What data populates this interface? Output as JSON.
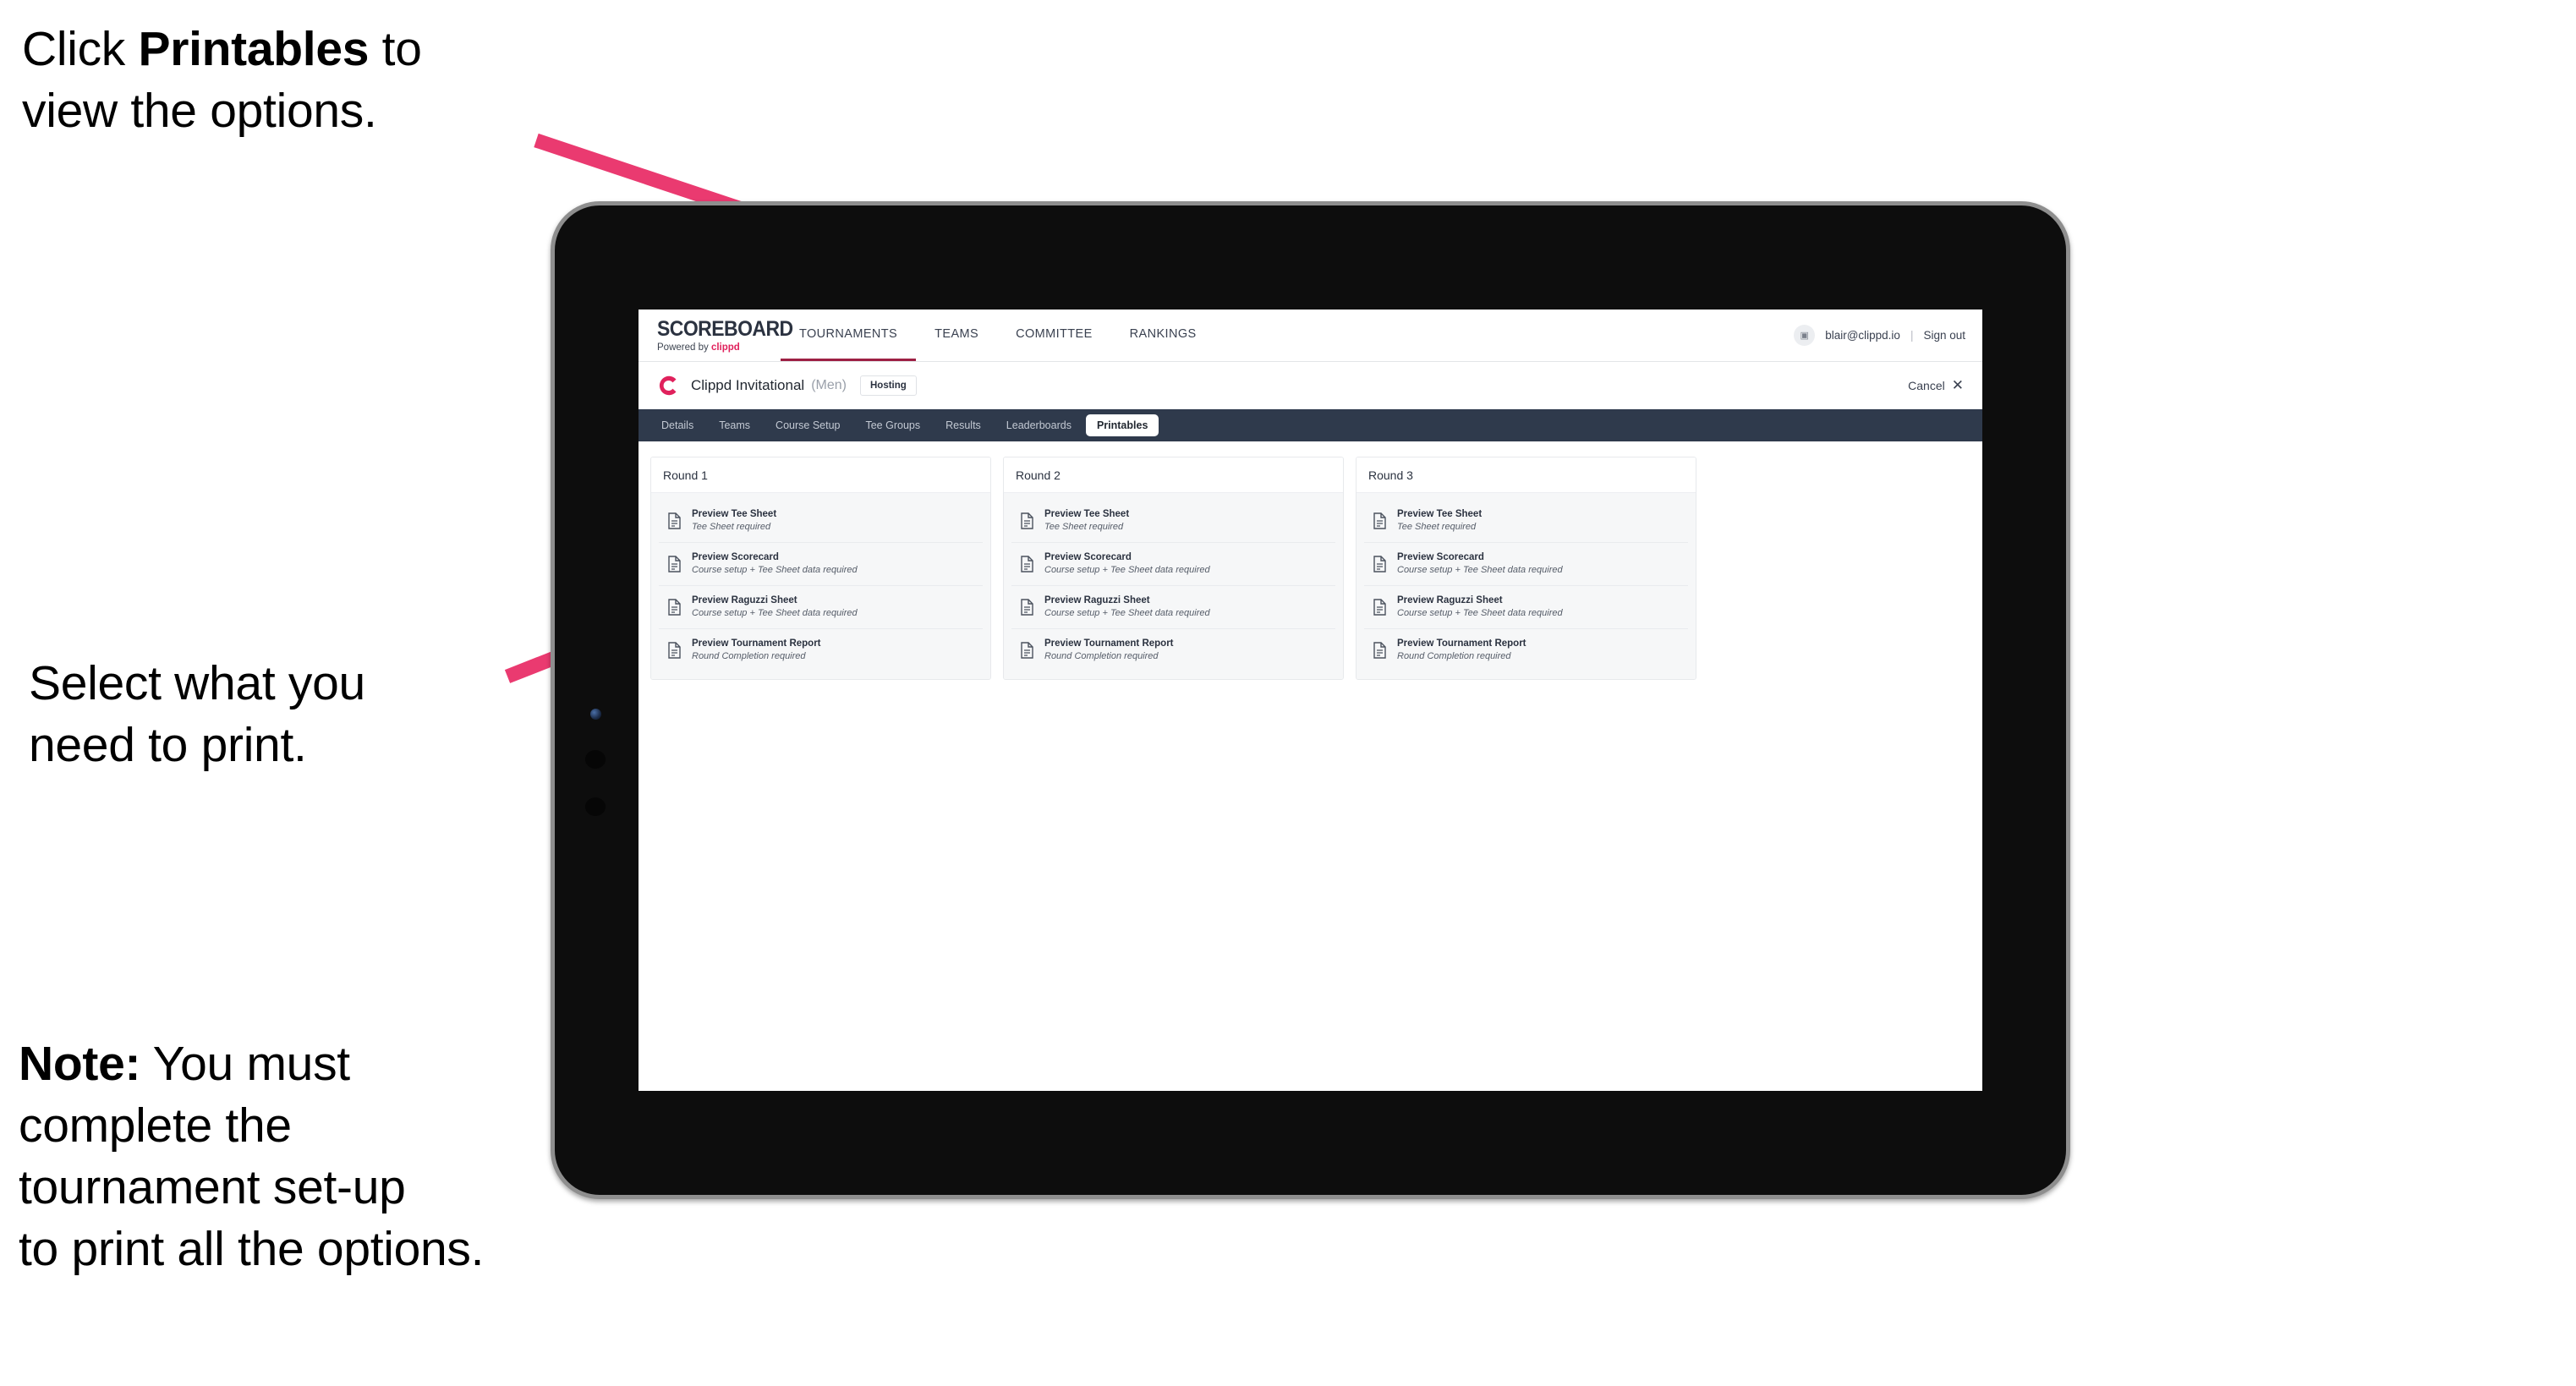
{
  "annotations": [
    {
      "id": "a1",
      "prefix": "Click ",
      "bold": "Printables",
      "suffix": " to\nview the options."
    },
    {
      "id": "a2",
      "prefix": "",
      "bold": "",
      "suffix": "Select what you\n need to print."
    },
    {
      "id": "a3",
      "prefix": "",
      "bold": "Note:",
      "suffix": " You must\ncomplete the\ntournament set-up\nto print all the options."
    }
  ],
  "annotation_text": {
    "one_pre": "Click ",
    "one_bold": "Printables",
    "one_post": " to\nview the options.",
    "two": "Select what you\n need to print.",
    "three_bold": "Note:",
    "three_post": " You must\ncomplete the\ntournament set-up\nto print all the options."
  },
  "colors": {
    "accent_pink": "#ea3a70",
    "brand_crimson": "#e0215c",
    "navbar_dark": "#2f3a4c",
    "active_underline": "#9d2044",
    "card_grey": "#f6f7f8",
    "bezel_black": "#0d0d0d",
    "bezel_edge": "#8e8e8e"
  },
  "brand": {
    "wordmark": "SCOREBOARD",
    "powered_prefix": "Powered by ",
    "powered_name": "clippd"
  },
  "main_nav": [
    {
      "label": "TOURNAMENTS",
      "active": true
    },
    {
      "label": "TEAMS",
      "active": false
    },
    {
      "label": "COMMITTEE",
      "active": false
    },
    {
      "label": "RANKINGS",
      "active": false
    }
  ],
  "account": {
    "avatar_glyph": "▣",
    "email": "blair@clippd.io",
    "separator": "|",
    "sign_out": "Sign out"
  },
  "tournament": {
    "logo_letter": "C",
    "name": "Clippd Invitational",
    "gender": "(Men)",
    "status_badge": "Hosting",
    "cancel_label": "Cancel",
    "cancel_x": "✕"
  },
  "tabs": [
    {
      "label": "Details",
      "active": false
    },
    {
      "label": "Teams",
      "active": false
    },
    {
      "label": "Course Setup",
      "active": false
    },
    {
      "label": "Tee Groups",
      "active": false
    },
    {
      "label": "Results",
      "active": false
    },
    {
      "label": "Leaderboards",
      "active": false
    },
    {
      "label": "Printables",
      "active": true
    }
  ],
  "rounds": [
    {
      "title": "Round 1",
      "items": [
        {
          "title": "Preview Tee Sheet",
          "sub": "Tee Sheet required"
        },
        {
          "title": "Preview Scorecard",
          "sub": "Course setup + Tee Sheet data required"
        },
        {
          "title": "Preview Raguzzi Sheet",
          "sub": "Course setup + Tee Sheet data required"
        },
        {
          "title": "Preview Tournament Report",
          "sub": "Round Completion required"
        }
      ]
    },
    {
      "title": "Round 2",
      "items": [
        {
          "title": "Preview Tee Sheet",
          "sub": "Tee Sheet required"
        },
        {
          "title": "Preview Scorecard",
          "sub": "Course setup + Tee Sheet data required"
        },
        {
          "title": "Preview Raguzzi Sheet",
          "sub": "Course setup + Tee Sheet data required"
        },
        {
          "title": "Preview Tournament Report",
          "sub": "Round Completion required"
        }
      ]
    },
    {
      "title": "Round 3",
      "items": [
        {
          "title": "Preview Tee Sheet",
          "sub": "Tee Sheet required"
        },
        {
          "title": "Preview Scorecard",
          "sub": "Course setup + Tee Sheet data required"
        },
        {
          "title": "Preview Raguzzi Sheet",
          "sub": "Course setup + Tee Sheet data required"
        },
        {
          "title": "Preview Tournament Report",
          "sub": "Round Completion required"
        }
      ]
    }
  ]
}
